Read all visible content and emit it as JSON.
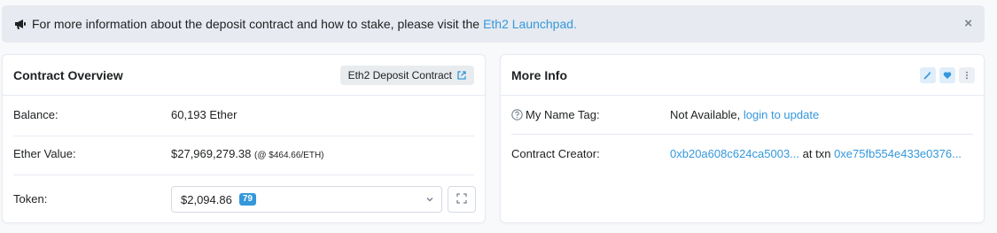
{
  "alert": {
    "text": "For more information about the deposit contract and how to stake, please visit the",
    "link": "Eth2 Launchpad.",
    "close": "×",
    "icon": "megaphone-icon"
  },
  "overview": {
    "title": "Contract Overview",
    "badge_label": "Eth2 Deposit Contract",
    "balance_label": "Balance:",
    "balance_value": "60,193 Ether",
    "ether_value_label": "Ether Value:",
    "ether_value": "$27,969,279.38",
    "ether_price": "(@ $464.66/ETH)",
    "token_label": "Token:",
    "token_value": "$2,094.86",
    "token_count": "79"
  },
  "more_info": {
    "title": "More Info",
    "name_tag_label": "My Name Tag:",
    "name_tag_value": "Not Available,",
    "name_tag_link": "login to update",
    "creator_label": "Contract Creator:",
    "creator_address": "0xb20a608c624ca5003...",
    "creator_at_txn": "at txn",
    "creator_txn": "0xe75fb554e433e0376..."
  },
  "colors": {
    "link": "#3498db",
    "alert_bg": "#e7eaf0",
    "badge_blue": "#3498db"
  }
}
